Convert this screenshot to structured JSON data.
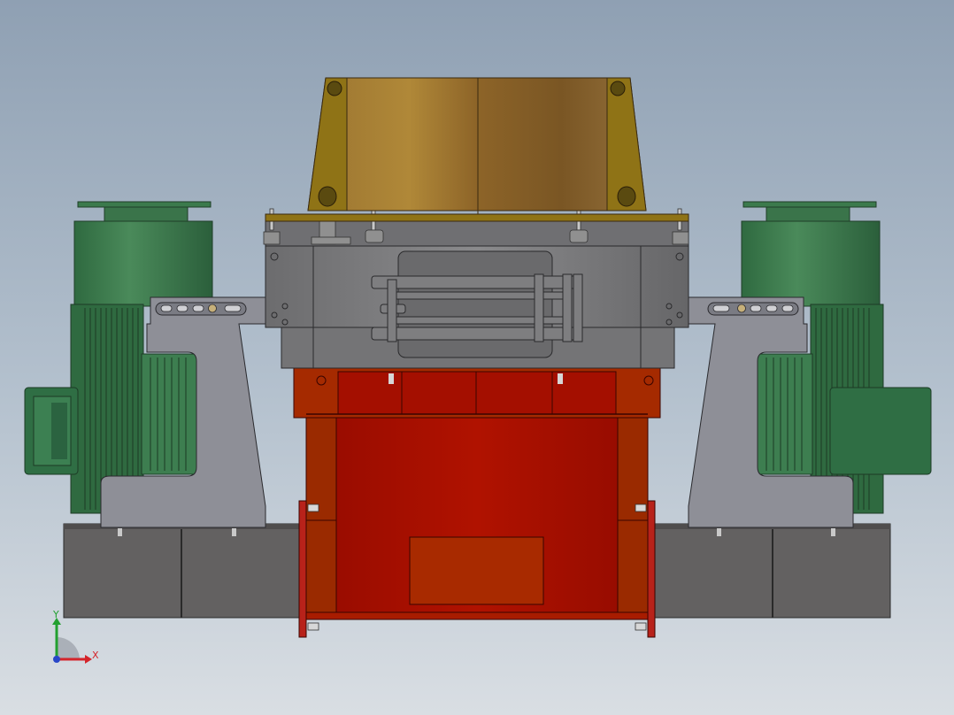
{
  "triad": {
    "x_label": "X",
    "y_label": "Y",
    "x_color": "#d4242a",
    "y_color": "#22a030",
    "z_color": "#2846c8"
  },
  "colors": {
    "hopper": "#a57a30",
    "hopper_frame": "#8f7316",
    "motor": "#3f7a4f",
    "housing": "#747476",
    "bracket": "#8f9098",
    "body": "#a80e00",
    "skid": "#626060"
  }
}
